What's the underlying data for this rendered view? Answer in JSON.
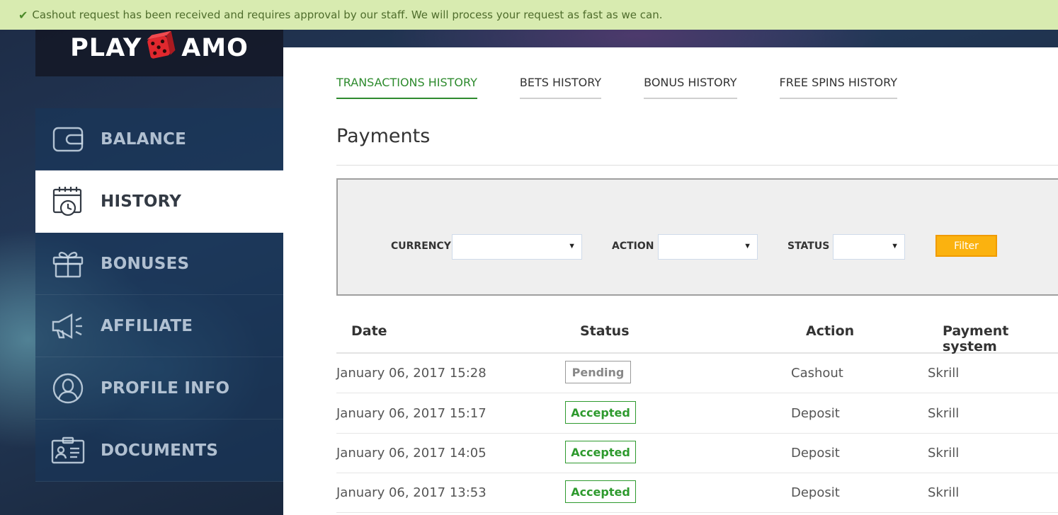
{
  "notice": {
    "icon": "check-icon",
    "text": "Cashout request has been received and requires approval by our staff. We will process your request as fast as we can."
  },
  "logo": {
    "left": "PLAY",
    "right": "AMO",
    "icon": "dice-icon"
  },
  "sidebar": {
    "items": [
      {
        "label": "BALANCE",
        "icon": "wallet-icon"
      },
      {
        "label": "HISTORY",
        "icon": "calendar-clock-icon",
        "active": true
      },
      {
        "label": "BONUSES",
        "icon": "gift-icon"
      },
      {
        "label": "AFFILIATE",
        "icon": "megaphone-icon"
      },
      {
        "label": "PROFILE INFO",
        "icon": "user-icon"
      },
      {
        "label": "DOCUMENTS",
        "icon": "id-card-icon"
      }
    ]
  },
  "tabs": [
    {
      "label": "TRANSACTIONS HISTORY",
      "active": true
    },
    {
      "label": "BETS HISTORY"
    },
    {
      "label": "BONUS HISTORY"
    },
    {
      "label": "FREE SPINS HISTORY"
    }
  ],
  "page_title": "Payments",
  "filters": {
    "currency_label": "CURRENCY",
    "currency_value": "",
    "action_label": "ACTION",
    "action_value": "",
    "status_label": "STATUS",
    "status_value": "",
    "button_label": "Filter"
  },
  "table": {
    "headers": [
      "Date",
      "Status",
      "Action",
      "Payment system"
    ],
    "rows": [
      {
        "date": "January 06, 2017 15:28",
        "status": "Pending",
        "action": "Cashout",
        "system": "Skrill"
      },
      {
        "date": "January 06, 2017 15:17",
        "status": "Accepted",
        "action": "Deposit",
        "system": "Skrill"
      },
      {
        "date": "January 06, 2017 14:05",
        "status": "Accepted",
        "action": "Deposit",
        "system": "Skrill"
      },
      {
        "date": "January 06, 2017 13:53",
        "status": "Accepted",
        "action": "Deposit",
        "system": "Skrill"
      }
    ]
  },
  "colors": {
    "accent": "#2e8b2e",
    "notice_bg": "#d8ebb0",
    "filter_button": "#fbb20f",
    "logo_dice": "#e0282e"
  }
}
